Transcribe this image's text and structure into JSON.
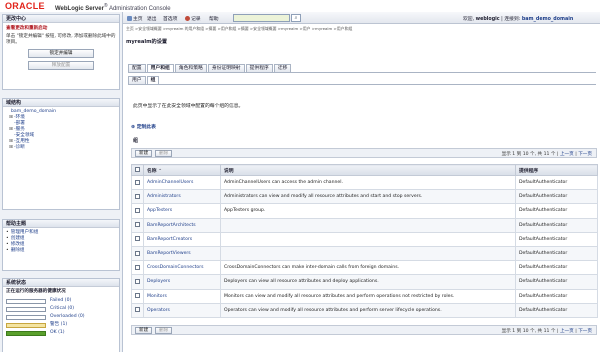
{
  "header": {
    "logo": "ORACLE",
    "product_name": "WebLogic Server",
    "product_suffix": "Administration Console"
  },
  "toolbar": {
    "home": "主页",
    "logout": "退出",
    "preferences": "首选项",
    "record": "记录",
    "help": "帮助",
    "search_value": "",
    "welcome_label": "欢迎,",
    "username": "weblogic",
    "connected_label": "连接到:",
    "domain": "bam_demo_domain"
  },
  "breadcrumb": "主页 >安全领域概要 >myrealm 的用户和组 >摘要 >用户和组 >摘要 >安全领域概要 >myrealm >用户 >myrealm >用户和组",
  "change_center": {
    "title": "更改中心",
    "link": "查看更改和重新启动",
    "description": "单击 \"锁定并编辑\" 按钮, 可修改, 添加或删除此域中的项目。",
    "lock_button": "锁定并编辑",
    "release_button": "释放配置"
  },
  "domain_structure": {
    "title": "域结构",
    "items": [
      {
        "toggle": "",
        "label": "bam_demo_domain"
      },
      {
        "toggle": "⊞",
        "label": "-环境"
      },
      {
        "toggle": "",
        "label": "-部署"
      },
      {
        "toggle": "⊞",
        "label": "-服务"
      },
      {
        "toggle": "",
        "label": "-安全领域"
      },
      {
        "toggle": "⊞",
        "label": "-互用性"
      },
      {
        "toggle": "⊞",
        "label": "-诊断"
      }
    ]
  },
  "help_topics": {
    "title": "帮助主题",
    "items": [
      "管理用户和组",
      "创建组",
      "修改组",
      "删除组"
    ]
  },
  "system_status": {
    "title": "系统状态",
    "subtitle": "正在运行的服务器的健康状况",
    "rows": [
      {
        "label": "Failed (0)",
        "count": 0
      },
      {
        "label": "Critical (0)",
        "count": 0
      },
      {
        "label": "Overloaded (0)",
        "count": 0
      },
      {
        "label": "警告 (1)",
        "count": 1
      },
      {
        "label": "OK (1)",
        "count": 1
      }
    ]
  },
  "main": {
    "settings_title": "myrealm的设置",
    "tabs": [
      "配置",
      "用户和组",
      "角色和策略",
      "身份证明映射",
      "提供程序",
      "迁移"
    ],
    "active_tab": 1,
    "subtabs": [
      "用户",
      "组"
    ],
    "active_subtab": 1,
    "intro": "此页中显示了在此安全领域中配置的每个组的信息。",
    "customize_link": "定制此表",
    "table_heading": "组",
    "new_button": "新建",
    "delete_button": "删除",
    "pager_text": "显示 1 到 10 个, 共 11 个",
    "prev": "上一页",
    "next": "下一页",
    "columns": [
      "名称",
      "说明",
      "提供程序"
    ],
    "rows": [
      {
        "name": "AdminChannelUsers",
        "description": "AdminChannelUsers can access the admin channel.",
        "provider": "DefaultAuthenticator"
      },
      {
        "name": "Administrators",
        "description": "Administrators can view and modify all resource attributes and start and stop servers.",
        "provider": "DefaultAuthenticator"
      },
      {
        "name": "AppTesters",
        "description": "AppTesters group.",
        "provider": "DefaultAuthenticator"
      },
      {
        "name": "BamReportArchitects",
        "description": "",
        "provider": "DefaultAuthenticator"
      },
      {
        "name": "BamReportCreators",
        "description": "",
        "provider": "DefaultAuthenticator"
      },
      {
        "name": "BamReportViewers",
        "description": "",
        "provider": "DefaultAuthenticator"
      },
      {
        "name": "CrossDomainConnectors",
        "description": "CrossDomainConnectors can make inter-domain calls from foreign domains.",
        "provider": "DefaultAuthenticator"
      },
      {
        "name": "Deployers",
        "description": "Deployers can view all resource attributes and deploy applications.",
        "provider": "DefaultAuthenticator"
      },
      {
        "name": "Monitors",
        "description": "Monitors can view and modify all resource attributes and perform operations not restricted by roles.",
        "provider": "DefaultAuthenticator"
      },
      {
        "name": "Operators",
        "description": "Operators can view and modify all resource attributes and perform server lifecycle operations.",
        "provider": "DefaultAuthenticator"
      }
    ]
  }
}
